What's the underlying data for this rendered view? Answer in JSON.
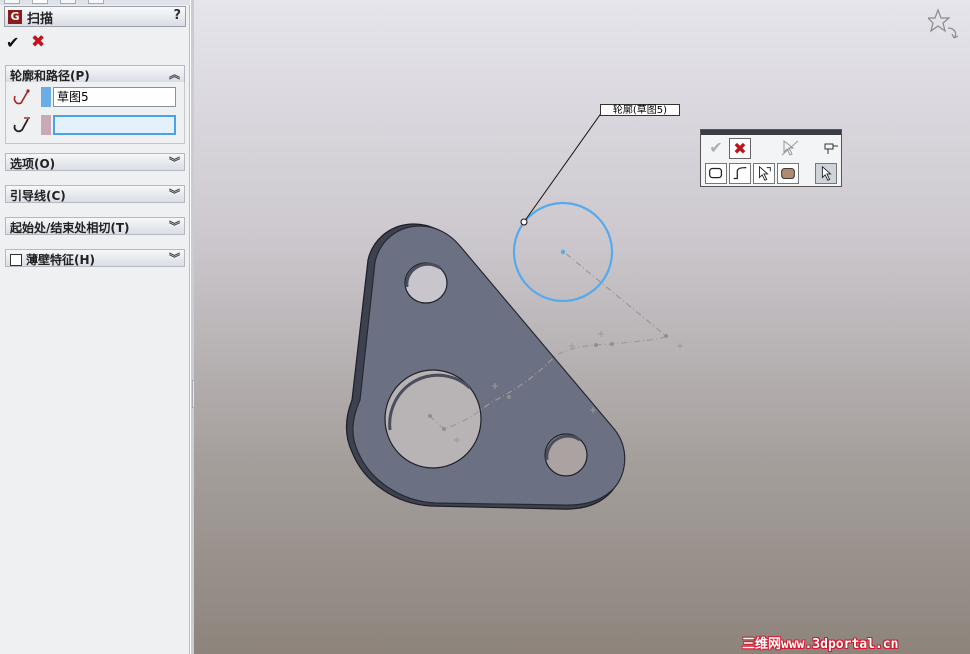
{
  "panel": {
    "title": "扫描",
    "help_label": "?",
    "ok_symbol": "✔",
    "cancel_symbol": "✖",
    "sections": {
      "profile_path": {
        "label": "轮廓和路径(P)",
        "profile_value": "草图5",
        "path_value": ""
      },
      "options": {
        "label": "选项(O)"
      },
      "guide_curves": {
        "label": "引导线(C)"
      },
      "tangency": {
        "label": "起始处/结束处相切(T)"
      },
      "thin_feature": {
        "label": "薄壁特征(H)",
        "checked": false
      }
    },
    "colors": {
      "profile_swatch": "#6aaee8",
      "path_swatch": "#c9a9b8",
      "active_field_border": "#4aa3e6",
      "title_icon": "#8b1c1c"
    }
  },
  "viewport": {
    "callout": "轮廓(草图5)",
    "colors": {
      "part": "#6b7183",
      "profile_circle": "#55aaee",
      "path": "#9a9a9a"
    }
  },
  "context_toolbar": {
    "buttons": [
      "ok",
      "cancel",
      "hide-icon",
      "pin-icon",
      "closed-loop-icon",
      "open-curve-icon",
      "select-chain-icon",
      "face-icon",
      "pointer-icon"
    ]
  },
  "watermark": "三维网www.3dportal.cn"
}
